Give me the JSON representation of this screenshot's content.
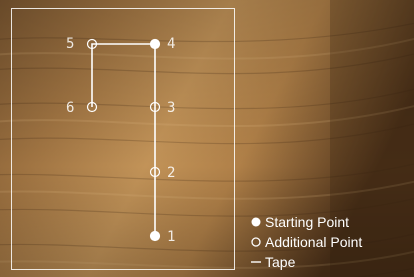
{
  "diagram": {
    "points": [
      {
        "label": "1",
        "type": "start"
      },
      {
        "label": "2",
        "type": "additional"
      },
      {
        "label": "3",
        "type": "additional"
      },
      {
        "label": "4",
        "type": "start"
      },
      {
        "label": "5",
        "type": "additional"
      },
      {
        "label": "6",
        "type": "additional"
      }
    ],
    "tape_path": [
      "1",
      "2",
      "3",
      "4",
      "5",
      "6"
    ]
  },
  "legend": {
    "starting_point": "Starting Point",
    "additional_point": "Additional Point",
    "tape": "Tape"
  },
  "colors": {
    "line": "#ffffff",
    "wood_dark": "#5a3a1c",
    "wood_light": "#c79a5e"
  }
}
